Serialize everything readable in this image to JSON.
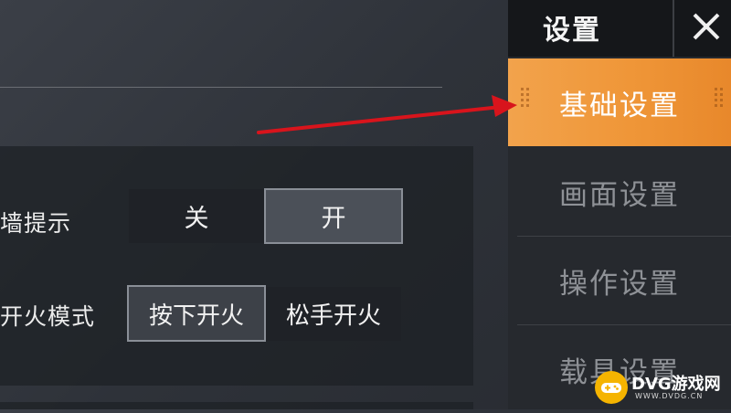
{
  "header": {
    "title": "设置",
    "close_icon": "close-icon"
  },
  "settings": {
    "wall_hint": {
      "label": "墙提示",
      "options": [
        "关",
        "开"
      ],
      "selected": "开"
    },
    "fire_mode": {
      "label": "开火模式",
      "options": [
        "按下开火",
        "松手开火"
      ],
      "selected": "按下开火"
    }
  },
  "sidebar": {
    "items": [
      {
        "label": "基础设置",
        "active": true
      },
      {
        "label": "画面设置",
        "active": false
      },
      {
        "label": "操作设置",
        "active": false
      },
      {
        "label": "载具设置",
        "active": false
      }
    ]
  },
  "annotation": {
    "arrow_color": "#d8141c",
    "points_to": "基础设置"
  },
  "watermark": {
    "brand": "DVG游戏网",
    "url": "WWW.DVDG.CN",
    "icon": "gamepad-icon"
  },
  "colors": {
    "accent": "#ef9638",
    "panel": "#1e2126",
    "sidebar": "#26292e"
  }
}
